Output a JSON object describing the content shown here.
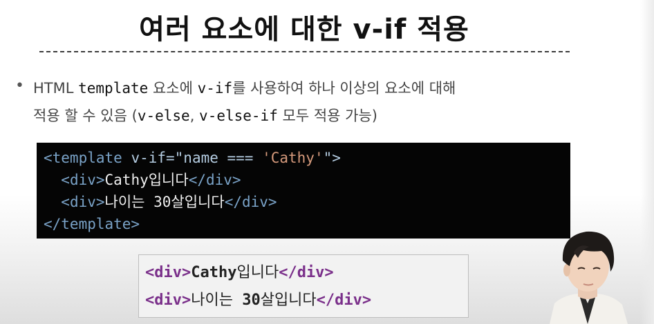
{
  "slide": {
    "title": "여러 요소에 대한 v-if 적용",
    "bullet": "•",
    "desc": {
      "line1_a": "HTML ",
      "line1_kw1": "template",
      "line1_b": " 요소에 ",
      "line1_kw2": "v-if",
      "line1_c": "를 사용하여 하나 이상의 요소에 대해",
      "line2_a": "적용 할 수 있음 (",
      "line2_kw1": "v-else",
      "line2_b": ", ",
      "line2_kw2": "v-else-if",
      "line2_c": " 모두 적용 가능)"
    }
  },
  "code": {
    "l1_open": "<template",
    "l1_attr": " v-if",
    "l1_eq": "=\"name === ",
    "l1_str": "'Cathy'",
    "l1_close": "\">",
    "l2_indent": "  ",
    "l2_open": "<div>",
    "l2_text": "Cathy입니다",
    "l2_close": "</div>",
    "l3_indent": "  ",
    "l3_open": "<div>",
    "l3_text": "나이는 30살입니다",
    "l3_close": "</div>",
    "l4_close": "</template>"
  },
  "output": {
    "l1_open": "<div>",
    "l1_text_b": "Cathy",
    "l1_text": "입니다",
    "l1_close": "</div>",
    "l2_open": "<div>",
    "l2_text": "나이는 ",
    "l2_text_b": "30",
    "l2_text2": "살입니다",
    "l2_close": "</div>"
  },
  "presenter": {
    "icon": "person-icon"
  }
}
